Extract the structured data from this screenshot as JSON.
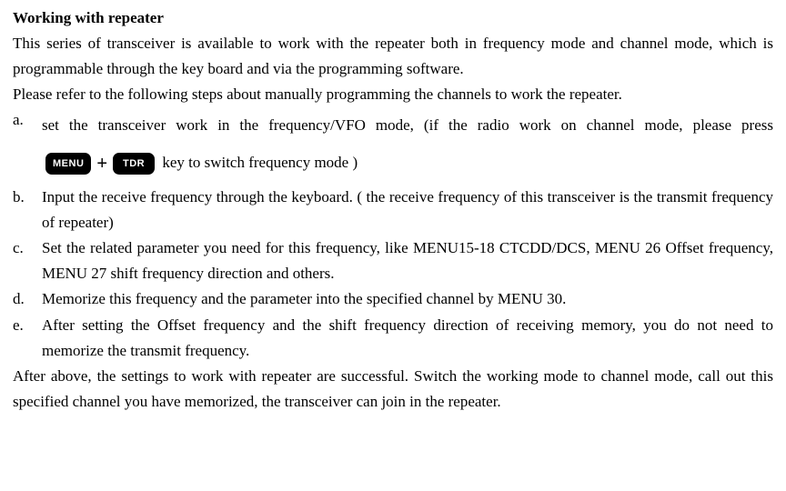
{
  "heading": "Working with repeater",
  "intro1": "This series of transceiver is available to work with the repeater both in frequency mode and channel mode, which is programmable through the key board and via the programming software.",
  "intro2": "Please refer to the following steps about manually programming the channels to work the repeater.",
  "items": {
    "a": {
      "marker": "a.",
      "pre": "set the transceiver work in the frequency/VFO mode, (if the radio work on channel mode, please press ",
      "key1": "MENU",
      "plus": "+",
      "key2": "TDR",
      "post": " key to switch frequency mode )"
    },
    "b": {
      "marker": "b.",
      "text": "Input the receive frequency through the keyboard. ( the receive frequency of this transceiver is the transmit frequency of repeater)"
    },
    "c": {
      "marker": "c.",
      "text": "Set the related parameter you need for this frequency, like MENU15-18 CTCDD/DCS, MENU 26 Offset frequency, MENU 27 shift frequency direction and others."
    },
    "d": {
      "marker": "d.",
      "text": "Memorize this frequency and the parameter into the specified channel by MENU 30."
    },
    "e": {
      "marker": "e.",
      "text": "After setting the Offset frequency and the shift frequency direction of receiving memory, you do not need to memorize the transmit frequency."
    }
  },
  "conclusion": "After above, the settings to work with repeater are successful. Switch the working mode to channel mode, call out this specified channel you have memorized, the transceiver can join in the repeater."
}
